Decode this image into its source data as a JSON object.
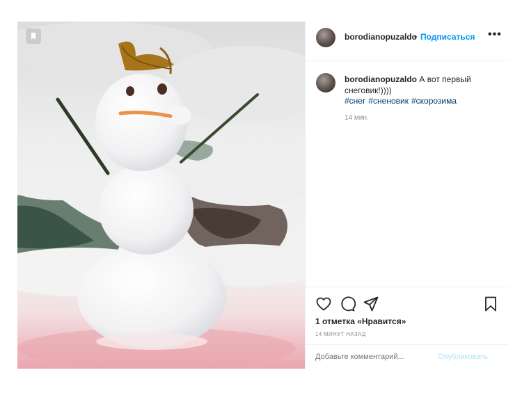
{
  "header": {
    "username": "borodianopuzaldo",
    "separator": "•",
    "follow_label": "Подписаться",
    "more_label": "•••"
  },
  "caption": {
    "username": "borodianopuzaldo",
    "text": "А вот первый снеговик!))))",
    "hashtags": [
      "#снег",
      "#сненовик",
      "#скорозима"
    ],
    "time": "14 мин."
  },
  "actions": {
    "likes": "1 отметка «Нравится»",
    "posted_ago": "14 МИНУТ НАЗАД",
    "icons": [
      "heart-icon",
      "comment-icon",
      "share-icon",
      "bookmark-icon"
    ]
  },
  "comment": {
    "placeholder": "Добавьте комментарий...",
    "publish_label": "Опубликовать"
  },
  "colors": {
    "accent": "#0095f6",
    "hashtag": "#00376b",
    "publish_disabled": "#b2dffc",
    "muted": "#8e8e8e"
  }
}
